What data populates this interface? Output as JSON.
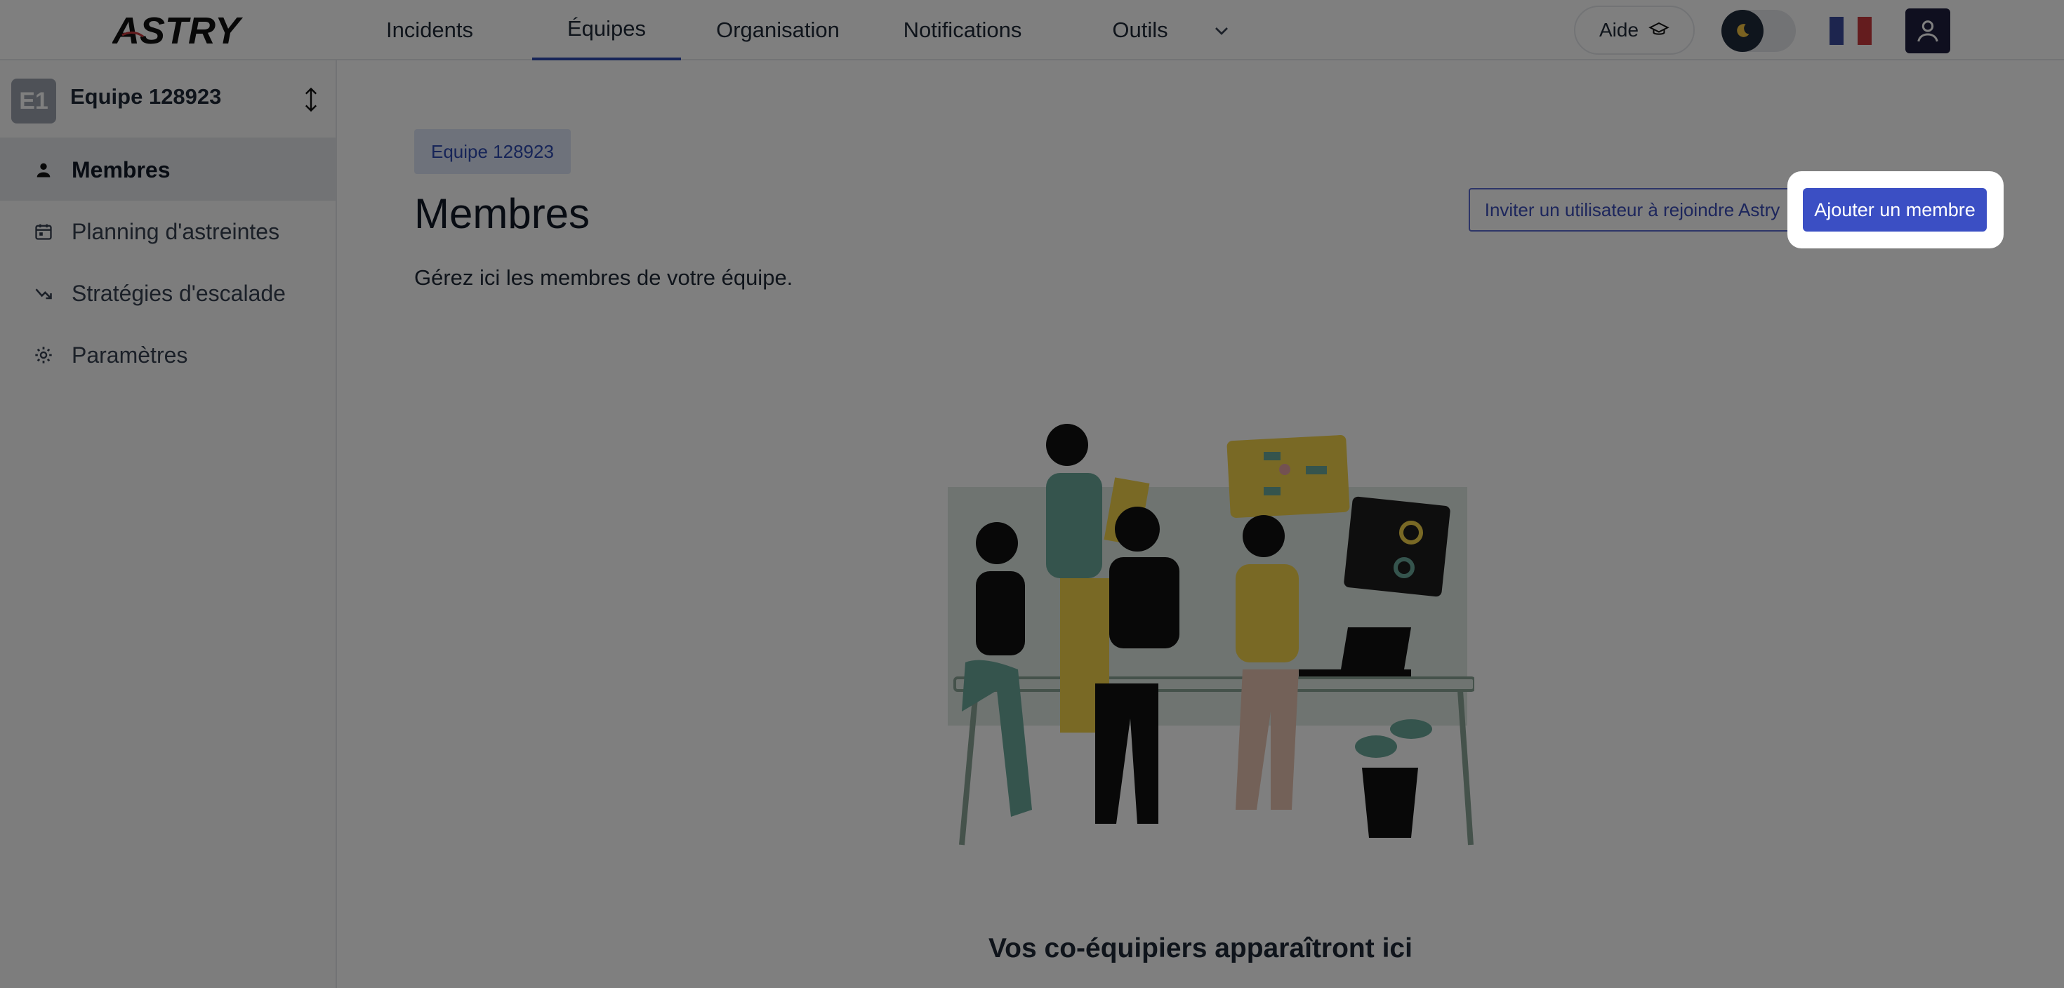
{
  "header": {
    "logo_text": "ASTRY",
    "nav": [
      {
        "label": "Incidents",
        "active": false
      },
      {
        "label": "Équipes",
        "active": true
      },
      {
        "label": "Organisation",
        "active": false
      },
      {
        "label": "Notifications",
        "active": false
      },
      {
        "label": "Outils",
        "active": false
      }
    ],
    "help_label": "Aide",
    "theme_toggle_icon": "moon-icon",
    "language_flag": "flag-fr-icon",
    "flag_colors": [
      "#3a4a9c",
      "#ffffff",
      "#c9393c"
    ],
    "account_icon": "user-icon"
  },
  "sidebar": {
    "team_badge": "E1",
    "team_name": "Equipe 128923",
    "items": [
      {
        "label": "Membres",
        "icon": "person-icon",
        "active": true
      },
      {
        "label": "Planning d'astreintes",
        "icon": "calendar-icon",
        "active": false
      },
      {
        "label": "Stratégies d'escalade",
        "icon": "trending-icon",
        "active": false
      },
      {
        "label": "Paramètres",
        "icon": "gear-icon",
        "active": false
      }
    ]
  },
  "main": {
    "team_chip": "Equipe 128923",
    "title": "Membres",
    "subtitle": "Gérez ici les membres de votre équipe.",
    "invite_button": "Inviter un utilisateur à rejoindre Astry",
    "add_button": "Ajouter un membre",
    "empty_title": "Vos co-équipiers apparaîtront ici",
    "empty_illustration": "team-meeting-illustration"
  },
  "colors": {
    "accent": "#3b4fc4",
    "nav_underline": "#2f4ab0",
    "chip_bg": "#dde5f6",
    "overlay": "rgba(0,0,0,0.5)"
  }
}
